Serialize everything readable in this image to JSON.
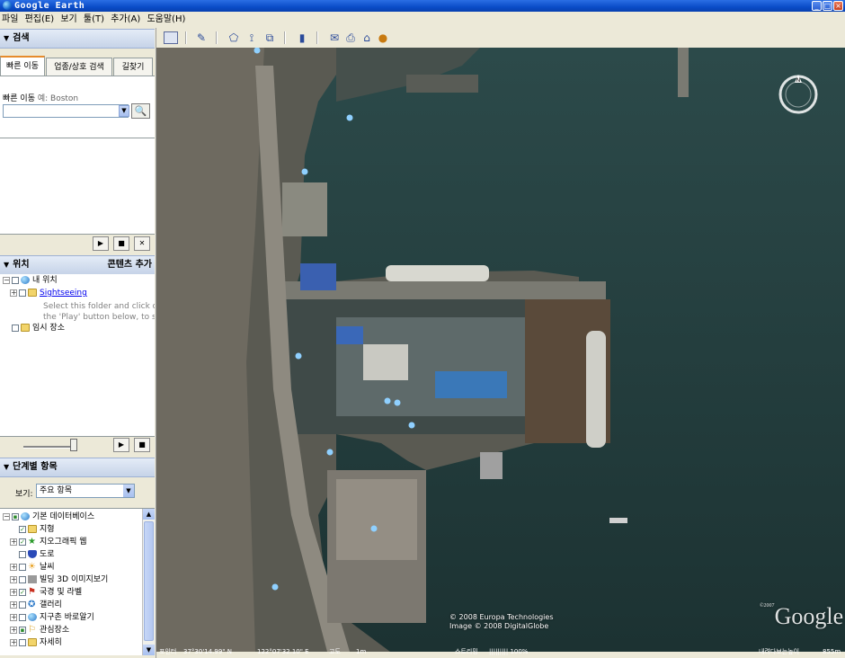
{
  "window": {
    "title": "Google Earth"
  },
  "menu": [
    "파일",
    "편집(E)",
    "보기",
    "툴(T)",
    "추가(A)",
    "도움말(H)"
  ],
  "search_panel": {
    "header": "검색",
    "tabs": [
      "빠른 이동",
      "업종/상호 검색",
      "길찾기"
    ],
    "label": "빠른 이동",
    "hint": "예: Boston",
    "input_value": ""
  },
  "places_panel": {
    "header": "위치",
    "add_content": "콘텐츠 추가",
    "my_places": "내 위치",
    "sightseeing": "Sightseeing",
    "desc1": "Select this folder and click o",
    "desc2": "the 'Play' button below, to st",
    "temp_places": "임시 장소"
  },
  "layers_panel": {
    "header": "단계별 항목",
    "view_label": "보기:",
    "view_value": "주요 항목",
    "items": [
      "기본 데이터베이스",
      "지형",
      "지오그래픽 웹",
      "도로",
      "날씨",
      "빌딩 3D 이미지보기",
      "국경 및 라벨",
      "갤러리",
      "지구촌 바로알기",
      "관심장소",
      "자세히"
    ]
  },
  "status": {
    "lat_label": "포인터",
    "lat": "37°30'14.99\" N",
    "lon": "122°07'32.10\" E",
    "elev_label": "고도",
    "elev": "1m",
    "stream_label": "스트리밍",
    "stream": "||||||||| 100%",
    "eye_label": "내려다보는높이",
    "eye": "855m"
  },
  "map": {
    "copyright1": "© 2008 Europa Technologies",
    "copyright2": "Image © 2008 DigitalGlobe",
    "logo": "Google",
    "logo_year": "©2007",
    "compass_n": "N"
  }
}
